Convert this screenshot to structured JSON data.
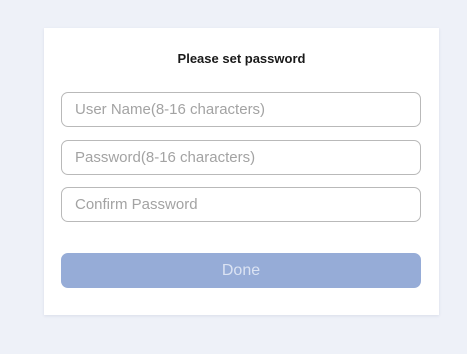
{
  "dialog": {
    "title": "Please set password",
    "fields": {
      "username": {
        "value": "",
        "placeholder": "User Name(8-16 characters)"
      },
      "password": {
        "value": "",
        "placeholder": "Password(8-16 characters)"
      },
      "confirm": {
        "value": "",
        "placeholder": "Confirm Password"
      }
    },
    "done_label": "Done"
  },
  "colors": {
    "page_background": "#eef1f8",
    "card_background": "#ffffff",
    "field_border": "#b9b9b9",
    "placeholder_text": "#a3a3a3",
    "button_disabled_bg": "#96acd7",
    "button_disabled_text": "#dbe3f3"
  }
}
